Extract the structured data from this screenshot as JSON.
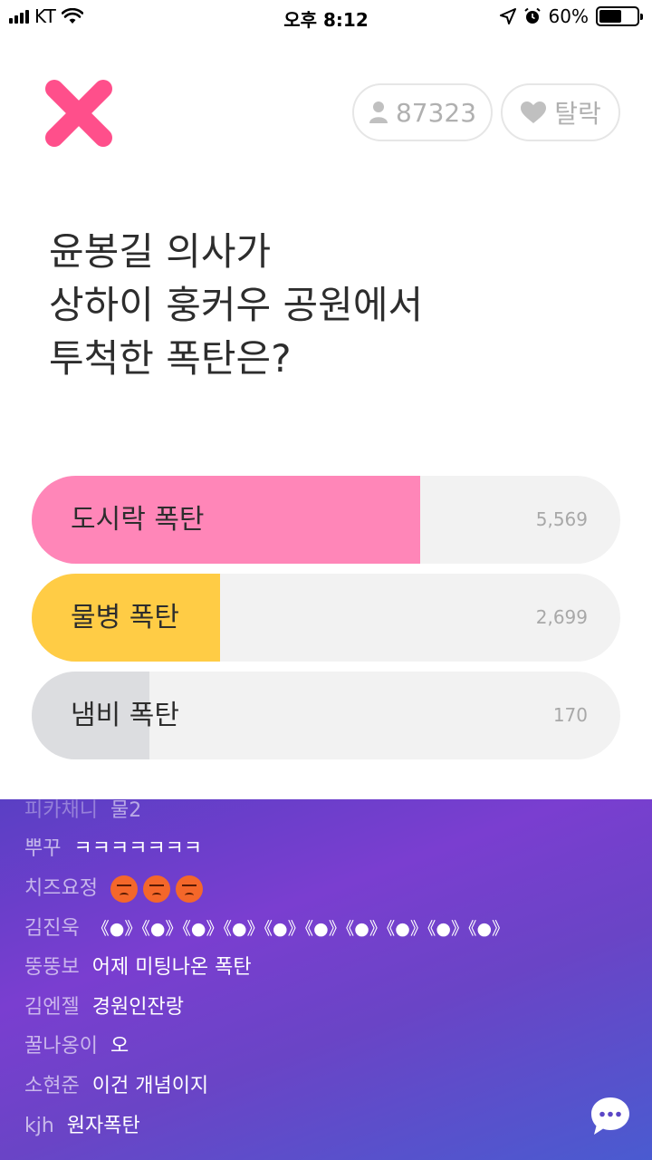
{
  "status_bar": {
    "carrier": "KT",
    "time": "오후 8:12",
    "battery": "60%",
    "battery_level": 0.6
  },
  "header": {
    "close_icon": "close-x-icon",
    "participants": "87323",
    "leave_label": "탈락",
    "accent_color": "#ff4f8b"
  },
  "question": {
    "lines": [
      "윤봉길 의사가",
      "상하이 훙커우 공원에서",
      "투척한 폭탄은?"
    ]
  },
  "options": [
    {
      "label": "도시락 폭탄",
      "count": "5,569",
      "share": 0.66,
      "color": "#ff86b8"
    },
    {
      "label": "물병 폭탄",
      "count": "2,699",
      "share": 0.32,
      "color": "#ffcc45"
    },
    {
      "label": "냄비 폭탄",
      "count": "170",
      "share": 0.2,
      "color": "#dcdde0"
    }
  ],
  "chat": [
    {
      "name": "피카채니",
      "msg": "물2"
    },
    {
      "name": "뿌꾸",
      "msg": "ㅋㅋㅋㅋㅋㅋㅋ"
    },
    {
      "name": "치즈요정",
      "msg": "",
      "emoji_count": 3,
      "emoji": "angry-face-icon"
    },
    {
      "name": "김진욱",
      "msg": "《●》《●》《●》《●》《●》《●》《●》《●》《●》《●》"
    },
    {
      "name": "뚱뚱보",
      "msg": "어제 미팅나온 폭탄"
    },
    {
      "name": "김엔젤",
      "msg": "경원인잔랑"
    },
    {
      "name": "꿀나옹이",
      "msg": "오"
    },
    {
      "name": "소현준",
      "msg": "이건 개념이지"
    },
    {
      "name": "kjh",
      "msg": "원자폭탄"
    }
  ],
  "chat_button_icon": "chat-bubble-icon"
}
